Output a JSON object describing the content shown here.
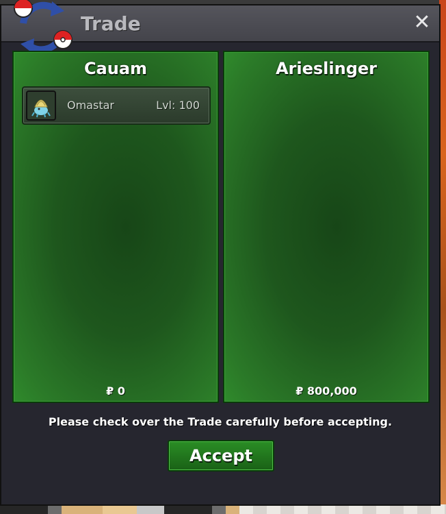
{
  "window": {
    "title": "Trade",
    "close_icon": "close-icon",
    "logo_icon": "pokeball-trade-icon"
  },
  "left_player": {
    "name": "Cauam",
    "pokemon": [
      {
        "name": "Omastar",
        "level": "Lvl: 100",
        "icon": "omastar-icon"
      }
    ],
    "money": "₽ 0"
  },
  "right_player": {
    "name": "Arieslinger",
    "pokemon": [],
    "money": "₽ 800,000"
  },
  "notice": "Please check over the Trade carefully before accepting.",
  "accept_label": "Accept",
  "colors": {
    "panel_green": "#1e571d",
    "accept_green": "#2a8d25",
    "window_bg": "#26262f"
  }
}
